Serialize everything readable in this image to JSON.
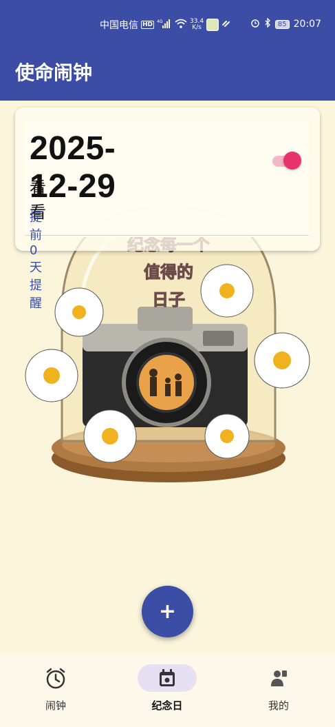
{
  "status_bar": {
    "carrier": "中国电信",
    "network_badge": "HD",
    "signal_type": "4G",
    "speed_value": "33.4",
    "speed_unit": "K/s",
    "battery": "85",
    "time": "20:07",
    "icons": [
      "hd-icon",
      "signal-icon",
      "wifi-icon",
      "app-icon",
      "link-icon",
      "alarm-icon",
      "bluetooth-icon",
      "battery-icon"
    ]
  },
  "header": {
    "title": "使命闹钟"
  },
  "card": {
    "date": "2025-12-29",
    "name": "看看",
    "remind_text": "提前0天提醒",
    "toggle_on": true
  },
  "illustration": {
    "caption_line1": "纪念每一个",
    "caption_line2": "值得的",
    "caption_line3": "日子"
  },
  "fab": {
    "label": "+"
  },
  "bottom_nav": {
    "items": [
      {
        "label": "闹钟",
        "icon": "alarm-clock-icon",
        "active": false
      },
      {
        "label": "纪念日",
        "icon": "calendar-icon",
        "active": true
      },
      {
        "label": "我的",
        "icon": "person-icon",
        "active": false
      }
    ]
  },
  "colors": {
    "primary": "#3c4da6",
    "accent": "#e8336e",
    "background": "#fbf5dc",
    "nav_active_pill": "#e6e0f5"
  }
}
